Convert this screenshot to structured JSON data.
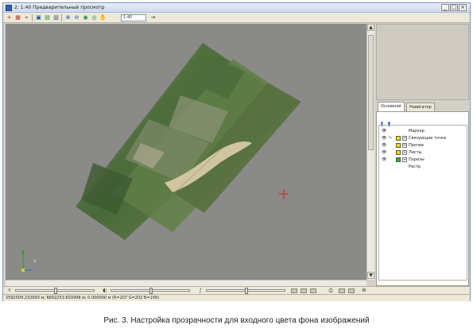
{
  "window": {
    "title": "2: 1:40 Предварительный просмотр",
    "controls": {
      "minimize": "_",
      "maximize": "□",
      "close": "×"
    }
  },
  "toolbar": {
    "icons": [
      "marker-add-icon",
      "grid-icon",
      "marker-tool-icon",
      "save-icon",
      "layers-icon",
      "image-icon",
      "zoom-in-icon",
      "zoom-out-icon",
      "zoom-fit-icon",
      "zoom-area-icon",
      "hand-icon"
    ],
    "scale_value": "1:40",
    "go_icon": "arrow-right-icon"
  },
  "map": {
    "background_color": "#8a8a88",
    "crosshair_color": "#d42020",
    "axes_label": "X"
  },
  "panel": {
    "tabs": [
      "Основной",
      "Навигатор"
    ],
    "active_tab": "Основной",
    "layers": [
      {
        "name": "Маркер",
        "swatch": "",
        "expandable": false
      },
      {
        "name": "Связующие точки",
        "swatch": "#f0e000",
        "expandable": true
      },
      {
        "name": "Прочее",
        "swatch": "#f0e000",
        "expandable": true
      },
      {
        "name": "Листы",
        "swatch": "#f0e000",
        "expandable": true
      },
      {
        "name": "Порезы",
        "swatch": "#2fb02f",
        "expandable": true
      },
      {
        "name": "Растр",
        "swatch": "",
        "expandable": false
      }
    ]
  },
  "status": {
    "text": "2592509.232993 м; 6602253.603998 м; 0.000000 м  (R=207 G=202 B=199)"
  },
  "caption": "Рис. 3. Настройка прозрачности для входного цвета фона изображений"
}
